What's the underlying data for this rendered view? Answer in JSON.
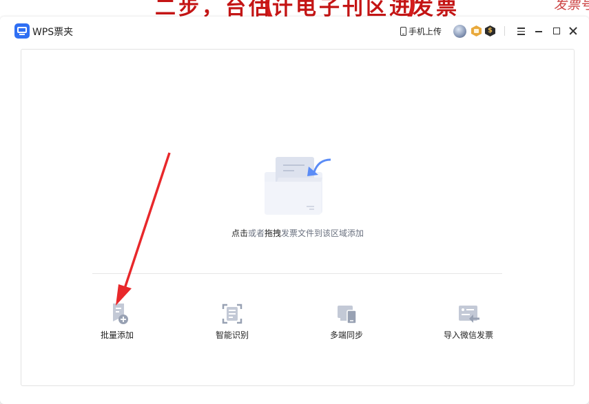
{
  "background": {
    "text_left": "二步，台估计电子刊区进发票",
    "text_right": "发票号"
  },
  "titlebar": {
    "app_title": "WPS票夹",
    "upload_label": "手机上传"
  },
  "drop_zone": {
    "hint_parts": [
      "点击",
      "或者",
      "拖拽",
      "发票文件到该区域添加"
    ]
  },
  "features": [
    {
      "label": "批量添加",
      "icon": "batch-add-icon"
    },
    {
      "label": "智能识别",
      "icon": "smart-recognize-icon"
    },
    {
      "label": "多端同步",
      "icon": "multi-device-sync-icon"
    },
    {
      "label": "导入微信发票",
      "icon": "import-wechat-invoice-icon"
    }
  ],
  "colors": {
    "brand_blue": "#2f6ff3",
    "accent_arrow": "#5b8cf6",
    "annotation_red": "#e8282b",
    "icon_gray": "#98a1b3"
  }
}
